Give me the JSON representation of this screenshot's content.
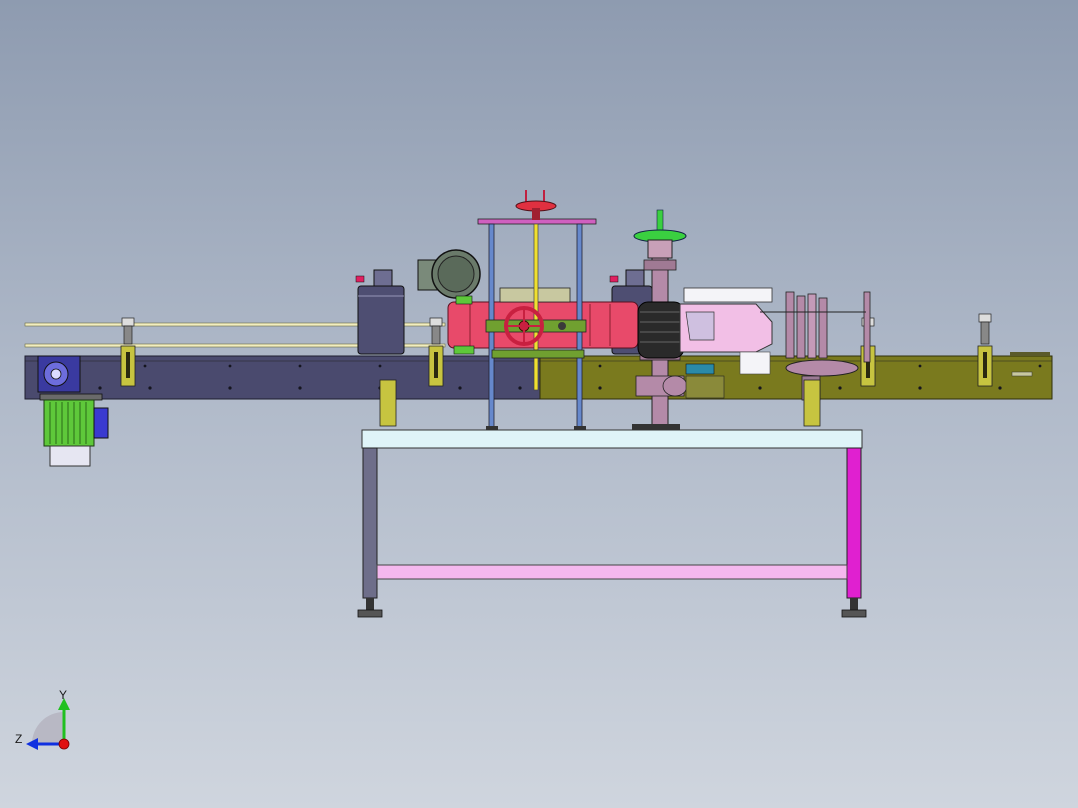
{
  "viewport": {
    "background_top": "#8e9bb0",
    "background_bottom": "#cfd5de"
  },
  "model": {
    "description_icon": "labeling-machine-cad-model",
    "conveyor_left_color": "#4a4a6e",
    "conveyor_right_color": "#7a7a1e",
    "table_top_color": "#dff4f8",
    "leg_right_color": "#e020d0",
    "crossbar_color": "#f5b8ee",
    "motor_color": "#5ec83a",
    "label_roller_color": "#e84a6a"
  },
  "triad": {
    "y_label": "Y",
    "z_label": "Z",
    "x_color": "#e01010",
    "y_color": "#20c020",
    "z_color": "#1030e0"
  }
}
